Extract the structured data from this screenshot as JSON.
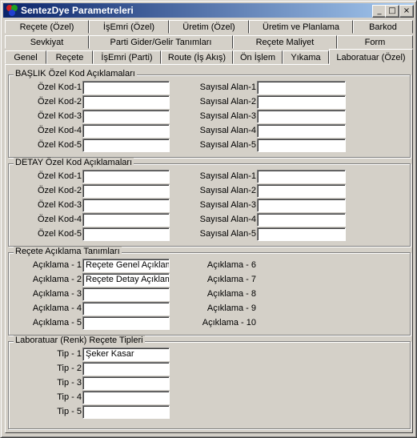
{
  "window": {
    "title": "SentezDye Parametreleri"
  },
  "titlebar_buttons": {
    "minimize": "_",
    "maximize": "□",
    "close": "×"
  },
  "tabs_row1": [
    "Reçete (Özel)",
    "İşEmri (Özel)",
    "Üretim (Özel)",
    "Üretim ve Planlama",
    "Barkod"
  ],
  "tabs_row2": [
    "Sevkiyat",
    "Parti Gider/Gelir Tanımları",
    "Reçete Maliyet",
    "Form"
  ],
  "tabs_row3": [
    "Genel",
    "Reçete",
    "İşEmri (Parti)",
    "Route (İş Akış)",
    "Ön İşlem",
    "Yıkama",
    "Laboratuar (Özel)"
  ],
  "baslik": {
    "legend": "BAŞLIK  Özel Kod Açıklamaları",
    "ozel_labels": [
      "Özel Kod-1",
      "Özel Kod-2",
      "Özel Kod-3",
      "Özel Kod-4",
      "Özel Kod-5"
    ],
    "ozel_values": [
      "",
      "",
      "",
      "",
      ""
    ],
    "sayisal_labels": [
      "Sayısal Alan-1",
      "Sayısal Alan-2",
      "Sayısal Alan-3",
      "Sayısal Alan-4",
      "Sayısal Alan-5"
    ],
    "sayisal_values": [
      "",
      "",
      "",
      "",
      ""
    ]
  },
  "detay": {
    "legend": "DETAY  Özel Kod Açıklamaları",
    "ozel_labels": [
      "Özel Kod-1",
      "Özel Kod-2",
      "Özel Kod-3",
      "Özel Kod-4",
      "Özel Kod-5"
    ],
    "ozel_values": [
      "",
      "",
      "",
      "",
      ""
    ],
    "sayisal_labels": [
      "Sayısal Alan-1",
      "Sayısal Alan-2",
      "Sayısal Alan-3",
      "Sayısal Alan-4",
      "Sayısal Alan-5"
    ],
    "sayisal_values": [
      "",
      "",
      "",
      "",
      ""
    ]
  },
  "recete": {
    "legend": "Reçete Açıklama Tanımları",
    "left_labels": [
      "Açıklama - 1",
      "Açıklama - 2",
      "Açıklama - 3",
      "Açıklama - 4",
      "Açıklama - 5"
    ],
    "left_values": [
      "Reçete Genel Açıklam",
      "Reçete Detay Açıklam",
      "",
      "",
      ""
    ],
    "right_labels": [
      "Açıklama - 6",
      "Açıklama - 7",
      "Açıklama - 8",
      "Açıklama - 9",
      "Açıklama - 10"
    ]
  },
  "lab": {
    "legend": "Laboratuar (Renk) Reçete Tipleri",
    "labels": [
      "Tip - 1",
      "Tip - 2",
      "Tip - 3",
      "Tip - 4",
      "Tip - 5"
    ],
    "values": [
      "Şeker Kasar",
      "",
      "",
      "",
      ""
    ]
  }
}
